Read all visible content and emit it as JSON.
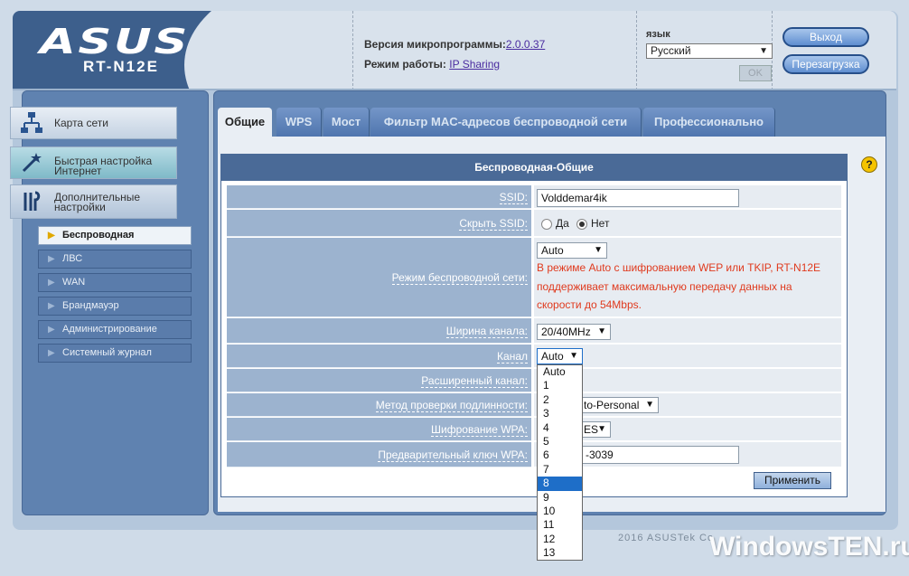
{
  "header": {
    "brand": "ASUS",
    "model": "RT-N12E",
    "firmware_label": "Версия микропрограммы:",
    "firmware_version": "2.0.0.37",
    "mode_label": "Режим работы:",
    "mode_value": "IP Sharing",
    "language_label": "язык",
    "language_value": "Русский",
    "ok_label": "OK",
    "logout_label": "Выход",
    "reboot_label": "Перезагрузка"
  },
  "sidebar": {
    "cards": [
      {
        "label1": "Карта сети",
        "label2": ""
      },
      {
        "label1": "Быстрая настройка",
        "label2": "Интернет"
      },
      {
        "label1": "Дополнительные",
        "label2": "настройки"
      }
    ],
    "items": [
      {
        "label": "Беспроводная",
        "active": true
      },
      {
        "label": "ЛВС"
      },
      {
        "label": "WAN"
      },
      {
        "label": "Брандмауэр"
      },
      {
        "label": "Администрирование"
      },
      {
        "label": "Системный журнал"
      }
    ]
  },
  "tabs": [
    "Общие",
    "WPS",
    "Мост",
    "Фильтр MAC-адресов беспроводной сети",
    "Профессионально"
  ],
  "panel": {
    "title": "Беспроводная-Общие",
    "ssid_label": "SSID:",
    "ssid_value": "Volddemar4ik",
    "hide_ssid_label": "Скрыть SSID:",
    "hide_yes": "Да",
    "hide_no": "Нет",
    "mode_label": "Режим беспроводной сети:",
    "mode_value": "Auto",
    "mode_warning_1": "В режиме Auto с шифрованием WEP или TKIP, RT-N12E",
    "mode_warning_2": "поддерживает максимальную передачу данных на",
    "mode_warning_3": "скорости до 54Mbps.",
    "bandwidth_label": "Ширина канала:",
    "bandwidth_value": "20/40MHz",
    "channel_label": "Канал",
    "channel_value": "Auto",
    "ext_channel_label": "Расширенный канал:",
    "auth_label": "Метод проверки подлинности:",
    "auth_value_visible": "to-Personal",
    "wpa_label": "Шифрование WPA:",
    "wpa_value_visible": "ES",
    "psk_label": "Предварительный ключ WPA:",
    "psk_value_visible": "-3039",
    "apply_label": "Применить"
  },
  "channel_options": [
    "Auto",
    "1",
    "2",
    "3",
    "4",
    "5",
    "6",
    "7",
    "8",
    "9",
    "10",
    "11",
    "12",
    "13"
  ],
  "channel_selected_index": 8,
  "footer": {
    "copyright": "2016 ASUSTek Co",
    "watermark": "WindowsTEN.ru"
  },
  "icons": {
    "network_map": "network-map-icon",
    "quick_setup": "magic-wand-icon",
    "advanced": "tools-icon",
    "help": "help-icon"
  },
  "colors": {
    "brand_blue": "#3d5f8c",
    "warning_red": "#e03a1e",
    "selection_blue": "#1e6ec8"
  }
}
